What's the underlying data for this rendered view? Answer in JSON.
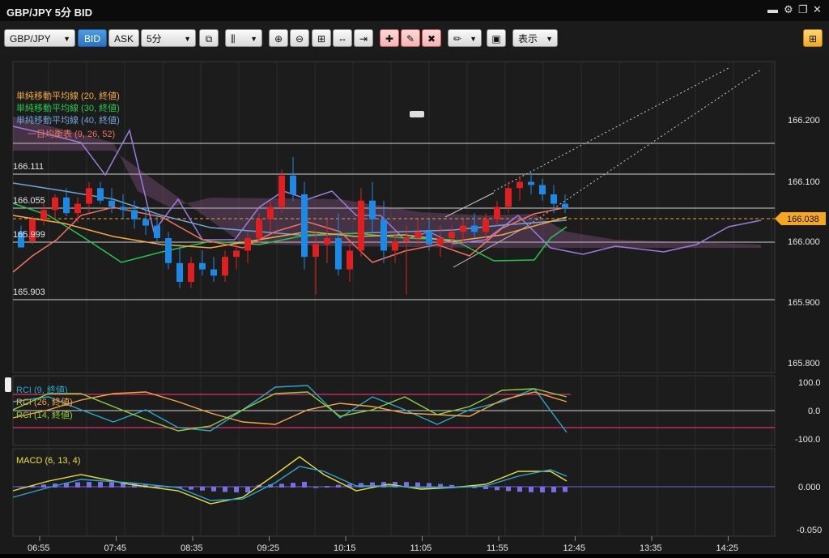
{
  "window": {
    "title": "GBP/JPY 5分 BID"
  },
  "toolbar": {
    "symbol": "GBP/JPY",
    "bid_label": "BID",
    "ask_label": "ASK",
    "timeframe": "5分",
    "display_label": "表示"
  },
  "colors": {
    "background": "#1a1a1a",
    "up_candle": "#e02020",
    "down_candle": "#1e88e5",
    "sma20": "#f4a742",
    "sma30": "#22c84b",
    "sma40": "#6fa3d6",
    "ichimoku": "#f07060",
    "price_tag": "#f5a623"
  },
  "main_panel": {
    "legend": [
      "単純移動平均線 (20, 終値)",
      "単純移動平均線 (30, 終値)",
      "単純移動平均線 (40, 終値)",
      "一目均衡表 (9, 26, 52)"
    ],
    "hline_labels": [
      "166.111",
      "166.055",
      "165.999",
      "165.903"
    ],
    "axis_ticks": [
      "166.200",
      "166.100",
      "166.000",
      "165.900",
      "165.800"
    ],
    "current_price": "166.038"
  },
  "rci_panel": {
    "legend": [
      "RCI (9, 終値)",
      "RCI (26, 終値)",
      "RCI (14, 終値)"
    ],
    "axis_ticks": [
      "100.0",
      "0.0",
      "-100.0"
    ]
  },
  "macd_panel": {
    "legend": "MACD (6, 13, 4)",
    "axis_ticks": [
      "0.000",
      "-0.050"
    ]
  },
  "time_axis": [
    "06:55",
    "07:45",
    "08:35",
    "09:25",
    "10:15",
    "11:05",
    "11:55",
    "12:45",
    "13:35",
    "14:25"
  ],
  "chart_data": {
    "type": "candlestick",
    "ylim": [
      165.78,
      166.27
    ],
    "candles": [
      [
        166.0,
        166.01,
        165.99,
        165.975
      ],
      [
        165.985,
        166.025,
        165.98,
        166.02
      ],
      [
        166.02,
        166.045,
        166.01,
        166.035
      ],
      [
        166.035,
        166.06,
        166.02,
        166.055
      ],
      [
        166.055,
        166.07,
        166.025,
        166.03
      ],
      [
        166.03,
        166.055,
        166.015,
        166.045
      ],
      [
        166.045,
        166.08,
        166.03,
        166.07
      ],
      [
        166.07,
        166.08,
        166.045,
        166.05
      ],
      [
        166.05,
        166.07,
        166.03,
        166.04
      ],
      [
        166.04,
        166.06,
        166.02,
        166.035
      ],
      [
        166.035,
        166.05,
        166.005,
        166.02
      ],
      [
        166.02,
        166.04,
        165.995,
        166.01
      ],
      [
        166.01,
        166.03,
        165.98,
        165.99
      ],
      [
        165.99,
        166.0,
        165.94,
        165.95
      ],
      [
        165.95,
        165.98,
        165.91,
        165.92
      ],
      [
        165.92,
        165.96,
        165.91,
        165.95
      ],
      [
        165.95,
        165.97,
        165.93,
        165.94
      ],
      [
        165.94,
        165.96,
        165.92,
        165.93
      ],
      [
        165.93,
        165.97,
        165.92,
        165.96
      ],
      [
        165.96,
        165.98,
        165.94,
        165.97
      ],
      [
        165.97,
        166.0,
        165.95,
        165.99
      ],
      [
        165.99,
        166.03,
        165.98,
        166.02
      ],
      [
        166.02,
        166.05,
        166.0,
        166.04
      ],
      [
        166.04,
        166.1,
        166.03,
        166.09
      ],
      [
        166.09,
        166.12,
        166.05,
        166.06
      ],
      [
        166.06,
        166.08,
        165.94,
        165.96
      ],
      [
        165.96,
        166.0,
        165.9,
        165.98
      ],
      [
        165.98,
        166.02,
        165.95,
        165.99
      ],
      [
        165.99,
        166.03,
        165.93,
        165.94
      ],
      [
        165.94,
        165.98,
        165.92,
        165.97
      ],
      [
        165.97,
        166.07,
        165.96,
        166.05
      ],
      [
        166.05,
        166.08,
        166.0,
        166.02
      ],
      [
        166.02,
        166.05,
        165.95,
        165.97
      ],
      [
        165.97,
        166.0,
        165.95,
        165.985
      ],
      [
        165.985,
        166.01,
        165.9,
        165.99
      ],
      [
        165.99,
        166.02,
        165.98,
        166.0
      ],
      [
        166.0,
        166.02,
        165.97,
        165.98
      ],
      [
        165.98,
        166.01,
        165.96,
        165.99
      ],
      [
        165.99,
        166.01,
        165.97,
        166.0
      ],
      [
        166.0,
        166.02,
        165.98,
        166.01
      ],
      [
        166.01,
        166.03,
        165.99,
        166.0
      ],
      [
        166.0,
        166.03,
        165.99,
        166.02
      ],
      [
        166.02,
        166.05,
        166.01,
        166.04
      ],
      [
        166.04,
        166.08,
        166.03,
        166.07
      ],
      [
        166.07,
        166.09,
        166.05,
        166.08
      ],
      [
        166.08,
        166.095,
        166.06,
        166.075
      ],
      [
        166.075,
        166.085,
        166.05,
        166.06
      ],
      [
        166.06,
        166.075,
        166.03,
        166.045
      ],
      [
        166.045,
        166.06,
        166.03,
        166.038
      ]
    ]
  }
}
